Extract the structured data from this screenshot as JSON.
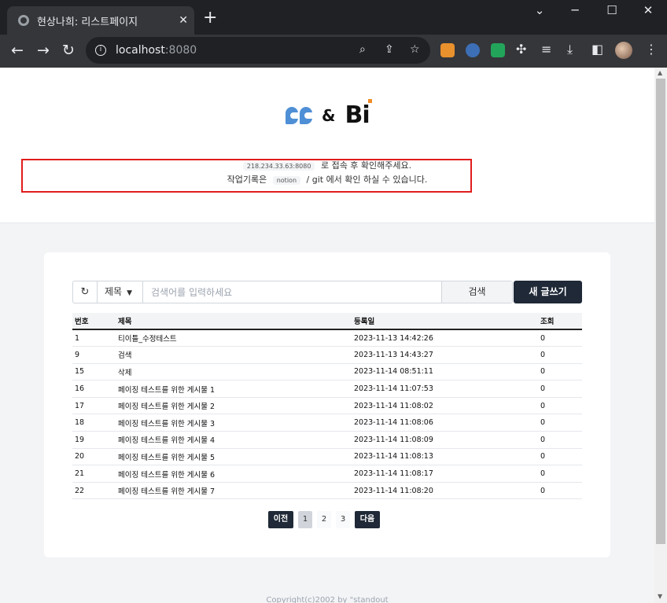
{
  "browser": {
    "tab_title": "현상나희: 리스트페이지",
    "tab_close": "✕",
    "new_tab": "+",
    "window": {
      "minimize": "⌄",
      "restore": "─",
      "maximize": "☐",
      "close": "✕"
    },
    "url_host": "localhost",
    "url_port": ":8080",
    "nav": {
      "back": "←",
      "forward": "→",
      "reload": "↻"
    }
  },
  "hero": {
    "logo_amp": "&",
    "logo_bi": "Bi",
    "line1_pill": "218.234.33.63:8080",
    "line1_text": "로 접속 후 확인해주세요.",
    "line2_prefix": "작업기록은",
    "line2_pill": "notion",
    "line2_suffix": "/ git 에서 확인 하실 수 있습니다."
  },
  "search": {
    "refresh_icon": "↻",
    "select_value": "제목",
    "input_placeholder": "검색어를 입력하세요",
    "search_label": "검색",
    "write_label": "새 글쓰기"
  },
  "table": {
    "headers": [
      "번호",
      "제목",
      "등록일",
      "조회"
    ],
    "rows": [
      [
        "1",
        "티이틀_수정테스트",
        "2023-11-13 14:42:26",
        "0"
      ],
      [
        "9",
        "검색",
        "2023-11-13 14:43:27",
        "0"
      ],
      [
        "15",
        "삭제",
        "2023-11-14 08:51:11",
        "0"
      ],
      [
        "16",
        "페이징 테스트를 위한 게시물 1",
        "2023-11-14 11:07:53",
        "0"
      ],
      [
        "17",
        "페이징 테스트를 위한 게시물 2",
        "2023-11-14 11:08:02",
        "0"
      ],
      [
        "18",
        "페이징 테스트를 위한 게시물 3",
        "2023-11-14 11:08:06",
        "0"
      ],
      [
        "19",
        "페이징 테스트를 위한 게시물 4",
        "2023-11-14 11:08:09",
        "0"
      ],
      [
        "20",
        "페이징 테스트를 위한 게시물 5",
        "2023-11-14 11:08:13",
        "0"
      ],
      [
        "21",
        "페이징 테스트를 위한 게시물 6",
        "2023-11-14 11:08:17",
        "0"
      ],
      [
        "22",
        "페이징 테스트를 위한 게시물 7",
        "2023-11-14 11:08:20",
        "0"
      ]
    ]
  },
  "pagination": {
    "prev": "이전",
    "pages": [
      "1",
      "2",
      "3"
    ],
    "current": "1",
    "next": "다음"
  },
  "footer": {
    "text": "Copyright(c)2002 by \"standout"
  },
  "colors": {
    "accent_dark": "#1f2937",
    "highlight": "#e11d1d",
    "logo_blue": "#4f8fd6",
    "logo_orange": "#f08c28"
  }
}
